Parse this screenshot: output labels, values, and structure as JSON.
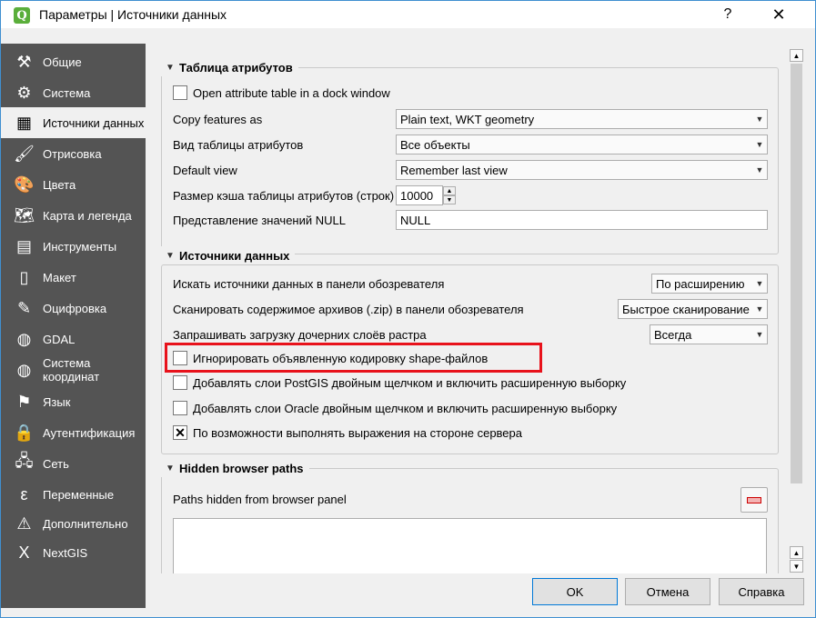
{
  "window": {
    "title": "Параметры | Источники данных",
    "help_label": "?",
    "close_label": "✕"
  },
  "sidebar": {
    "items": [
      {
        "label": "Общие",
        "icon": "tools-icon",
        "glyph": "⚒"
      },
      {
        "label": "Система",
        "icon": "gears-icon",
        "glyph": "⚙"
      },
      {
        "label": "Источники данных",
        "icon": "table-icon",
        "glyph": "▦"
      },
      {
        "label": "Отрисовка",
        "icon": "brush-icon",
        "glyph": "🖌"
      },
      {
        "label": "Цвета",
        "icon": "palette-icon",
        "glyph": "🎨"
      },
      {
        "label": "Карта и легенда",
        "icon": "map-icon",
        "glyph": "🗺"
      },
      {
        "label": "Инструменты",
        "icon": "toolbox-icon",
        "glyph": "▤"
      },
      {
        "label": "Макет",
        "icon": "layout-icon",
        "glyph": "▯"
      },
      {
        "label": "Оцифровка",
        "icon": "digitize-icon",
        "glyph": "✎"
      },
      {
        "label": "GDAL",
        "icon": "globe-icon",
        "glyph": "◍"
      },
      {
        "label": "Система координат",
        "icon": "crs-globe-icon",
        "glyph": "◍"
      },
      {
        "label": "Язык",
        "icon": "flags-icon",
        "glyph": "⚑"
      },
      {
        "label": "Аутентификация",
        "icon": "lock-icon",
        "glyph": "🔒"
      },
      {
        "label": "Сеть",
        "icon": "network-icon",
        "glyph": "🖧"
      },
      {
        "label": "Переменные",
        "icon": "epsilon-icon",
        "glyph": "ε"
      },
      {
        "label": "Дополнительно",
        "icon": "warning-icon",
        "glyph": "⚠"
      },
      {
        "label": "NextGIS",
        "icon": "nextgis-icon",
        "glyph": "X"
      }
    ]
  },
  "attribute_table": {
    "title": "Таблица атрибутов",
    "dock_label": "Open attribute table in a dock window",
    "copy_label": "Copy features as",
    "copy_value": "Plain text, WKT geometry",
    "view_label": "Вид таблицы атрибутов",
    "view_value": "Все объекты",
    "default_label": "Default view",
    "default_value": "Remember last view",
    "cache_label": "Размер кэша таблицы атрибутов (строк)",
    "cache_value": "10000",
    "null_label": "Представление значений NULL",
    "null_value": "NULL"
  },
  "data_sources": {
    "title": "Источники данных",
    "scan_label": "Искать источники данных в панели обозревателя",
    "scan_value": "По расширению",
    "zip_label": "Сканировать содержимое архивов (.zip) в панели обозревателя",
    "zip_value": "Быстрое сканирование",
    "child_label": "Запрашивать загрузку дочерних слоёв растра",
    "child_value": "Всегда",
    "ignore_label": "Игнорировать объявленную кодировку shape-файлов",
    "postgis_label": "Добавлять слои PostGIS двойным щелчком и включить расширенную выборку",
    "oracle_label": "Добавлять слои Oracle двойным щелчком и включить расширенную выборку",
    "server_label": "По возможности выполнять выражения на стороне сервера"
  },
  "hidden_paths": {
    "title": "Hidden browser paths",
    "label": "Paths hidden from browser panel"
  },
  "buttons": {
    "ok": "OK",
    "cancel": "Отмена",
    "help": "Справка"
  }
}
